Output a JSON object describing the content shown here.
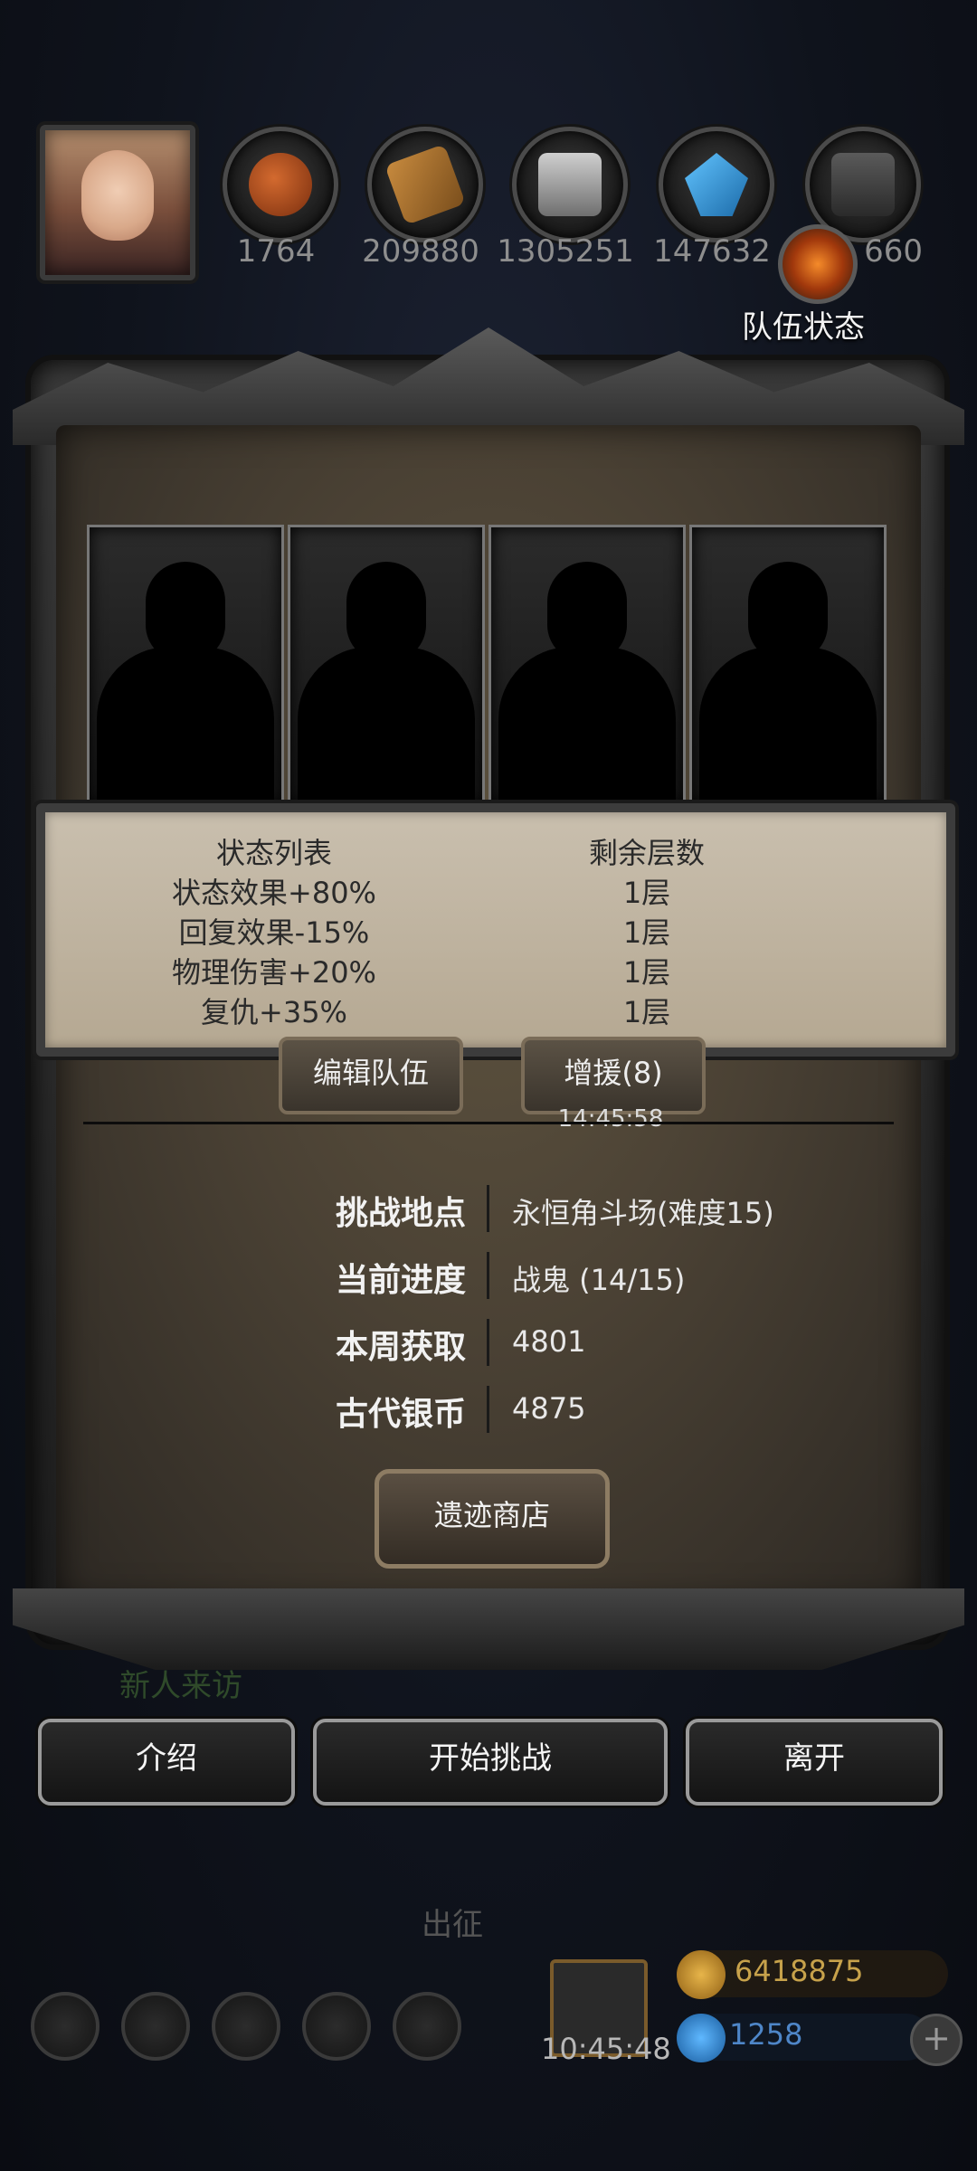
{
  "top_bar": {
    "resources": [
      {
        "name": "meat-resource",
        "value": "1764"
      },
      {
        "name": "wood-resource",
        "value": "209880"
      },
      {
        "name": "iron-resource",
        "value": "1305251"
      },
      {
        "name": "crystal-resource",
        "value": "147632"
      },
      {
        "name": "stone-resource",
        "value": "660"
      }
    ],
    "team_status_label": "队伍状态"
  },
  "status_table": {
    "header": {
      "name": "状态列表",
      "layers": "剩余层数"
    },
    "rows": [
      {
        "name": "状态效果+80%",
        "layers": "1层"
      },
      {
        "name": "回复效果-15%",
        "layers": "1层"
      },
      {
        "name": "物理伤害+20%",
        "layers": "1层"
      },
      {
        "name": "复仇+35%",
        "layers": "1层"
      }
    ]
  },
  "team_buttons": {
    "edit_team": "编辑队伍",
    "reinforce": "增援(8)",
    "reinforce_timer": "14:45:58"
  },
  "info": {
    "location_label": "挑战地点",
    "location_value": "永恒角斗场(难度15)",
    "progress_label": "当前进度",
    "progress_value": "战鬼 (14/15)",
    "weekly_label": "本周获取",
    "weekly_value": "4801",
    "coin_label": "古代银币",
    "coin_value": "4875"
  },
  "shop_button": "遗迹商店",
  "actions": {
    "intro": "介绍",
    "start": "开始挑战",
    "leave": "离开"
  },
  "background": {
    "newcomer_text": "新人来访",
    "expedition_text": "出征",
    "gift_timer": "10:45:48",
    "gold": "6418875",
    "gems": "1258",
    "plus": "+"
  },
  "colors": {
    "panel_parchment": "#b5a892",
    "panel_brown": "#4a4134",
    "button_border": "#9a9a9a"
  }
}
